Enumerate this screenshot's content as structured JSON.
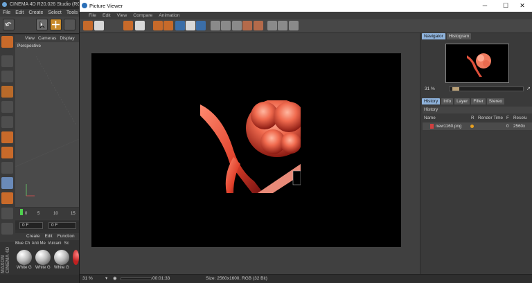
{
  "c4d": {
    "title": "CINEMA 4D R20.026 Studio (RC -",
    "menu": [
      "File",
      "Edit",
      "Create",
      "Select",
      "Tools"
    ],
    "viewport_menu": [
      "View",
      "Cameras",
      "Display"
    ],
    "viewport_label": "Perspective",
    "timeline_ticks": [
      "0",
      "5",
      "10",
      "15"
    ],
    "frame_field_1": "0 F",
    "frame_field_2": "0 F",
    "material_menu": [
      "Create",
      "Edit",
      "Function"
    ],
    "material_names_top": [
      "Blue Ch",
      "Anti Me",
      "Vulcani",
      "Sc"
    ],
    "material_names_bottom": [
      "White G",
      "White G",
      "White G"
    ],
    "brand": "MAXON CINEMA 4D"
  },
  "picture_viewer": {
    "title": "Picture Viewer",
    "window_controls": {
      "minimize": "─",
      "maximize": "☐",
      "close": "✕"
    },
    "menu": [
      "File",
      "Edit",
      "View",
      "Compare",
      "Animation"
    ],
    "tabs_top": [
      "Navigator",
      "Histogram"
    ],
    "active_top_tab": "Navigator",
    "zoom_value": "31 %",
    "zoom_fraction": 0.1,
    "tabs_bottom": [
      "History",
      "Info",
      "Layer",
      "Filter",
      "Stereo"
    ],
    "active_bottom_tab": "History",
    "history_title": "History",
    "history_columns": {
      "name": "Name",
      "r": "R",
      "render_time": "Render Time",
      "f": "F",
      "resolution": "Resolu"
    },
    "history_rows": [
      {
        "name": "new1160.png",
        "render_time": "",
        "frame": "0",
        "resolution": "2560x"
      }
    ],
    "status": {
      "zoom": "31 %",
      "time": "00:01:33",
      "size": "Size: 2560x1600, RGB (32 Bit)"
    },
    "colors": {
      "render_red": "#e0503a",
      "accent_tab": "#8fb3dc",
      "status_dot": "#e7a020"
    }
  }
}
